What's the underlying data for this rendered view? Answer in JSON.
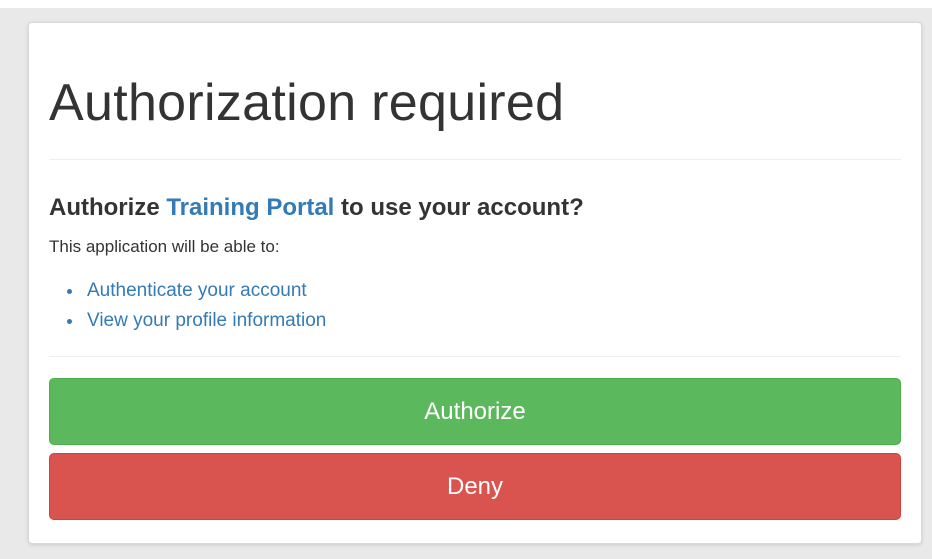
{
  "page": {
    "title": "Authorization required"
  },
  "prompt": {
    "prefix": "Authorize ",
    "app_name": "Training Portal",
    "suffix": " to use your account?"
  },
  "description": "This application will be able to:",
  "permissions": [
    "Authenticate your account",
    "View your profile information"
  ],
  "buttons": {
    "authorize_label": "Authorize",
    "deny_label": "Deny"
  },
  "colors": {
    "link": "#337ab7",
    "authorize": "#5cb85c",
    "deny": "#d9534f",
    "text": "#333333"
  }
}
